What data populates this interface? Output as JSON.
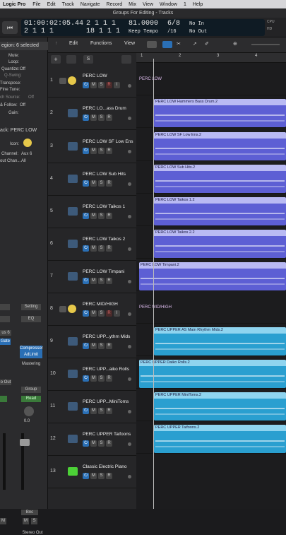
{
  "menubar": {
    "app": "Logic Pro",
    "items": [
      "File",
      "Edit",
      "Track",
      "Navigate",
      "Record",
      "Mix",
      "View",
      "Window",
      "1",
      "Help"
    ]
  },
  "window": {
    "title": "Groups For Editing - Tracks"
  },
  "transport": {
    "rewind_icon": "rewind-icon",
    "time": "01:00:02:05.44",
    "bars": "2  1  1  1",
    "bars2": "2  1  1  1",
    "bars3": "18  1  1  1",
    "tempo": "81.0000",
    "tempo_mode": "Keep Tempo",
    "sig": "6/8",
    "division": "/16",
    "in": "No In",
    "out": "No Out",
    "right_labels": [
      "CPU",
      "HD"
    ]
  },
  "inspector": {
    "region_label": "egion: 6 selected",
    "mute": "Mute:",
    "loop": "Loop:",
    "quantize": "Quantize:",
    "quantize_val": "Off",
    "qswing": "Q-Swing:",
    "transpose": "Transpose:",
    "finetune": "Fine Tune:",
    "source": "ch Source:",
    "source_val": "Off",
    "follow": "& Follow:",
    "follow_val": "Off",
    "gain": "Gain:",
    "track_label": "ack: PERC LOW",
    "icon": "Icon:",
    "channel": "Channel:",
    "channel_val": "Aux 6",
    "outchan": "out Chan...",
    "outchan_val": "All",
    "setting": "Setting",
    "eq": "EQ",
    "bus": "us 6",
    "gate": "Gate",
    "compressor": "Compressor",
    "adlimit": "AdLimit",
    "mastering": "Mastering",
    "out": "o Out",
    "group": "Group",
    "read": "Read",
    "val": "0.0",
    "bnc": "Bnc",
    "m": "M",
    "s": "S",
    "stereo_out": "Stereo Out",
    "read2": "Read"
  },
  "toolbar": {
    "edit": "Edit",
    "functions": "Functions",
    "view": "View"
  },
  "tracks": [
    {
      "num": "1",
      "name": "PERC LOW",
      "folder": true
    },
    {
      "num": "2",
      "name": "PERC LO...ass Drum"
    },
    {
      "num": "3",
      "name": "PERC LOW SF Low Ens"
    },
    {
      "num": "4",
      "name": "PERC LOW Sub Hits"
    },
    {
      "num": "5",
      "name": "PERC LOW Taikos 1"
    },
    {
      "num": "6",
      "name": "PERC LOW Taikos 2"
    },
    {
      "num": "7",
      "name": "PERC LOW Timpani"
    },
    {
      "num": "8",
      "name": "PERC MID/HIGH",
      "folder": true
    },
    {
      "num": "9",
      "name": "PERC UPP...ythm Mids"
    },
    {
      "num": "10",
      "name": "PERC UPP...aiko Rolls"
    },
    {
      "num": "11",
      "name": "PERC UPP...MiniToms"
    },
    {
      "num": "12",
      "name": "PERC UPPER Taifoons"
    },
    {
      "num": "13",
      "name": "Classic Electric Piano"
    }
  ],
  "track_buttons": {
    "m": "M",
    "s": "S",
    "r": "R",
    "i": "I"
  },
  "ruler": {
    "marks": [
      "1",
      "2",
      "3",
      "4"
    ]
  },
  "regions": [
    {
      "label": "PERC LOW",
      "kind": "folder"
    },
    {
      "label": "PERC LOW Hammers Bass Drum.2"
    },
    {
      "label": "PERC LOW SF Low Ens.2"
    },
    {
      "label": "PERC LOW Sub Hits.2"
    },
    {
      "label": "PERC LOW Taikos 1.2"
    },
    {
      "label": "PERC LOW Taikos 2.2"
    },
    {
      "label": "PERC LOW Timpani.2"
    },
    {
      "label": "PERC MID/HIGH",
      "kind": "folder"
    },
    {
      "label": "PERC UPPER AS Main Rhythm Mids.2"
    },
    {
      "label": "PERC UPPER Daiko Rolls.2"
    },
    {
      "label": "PERC UPPER MiniToms.2"
    },
    {
      "label": "PERC UPPER Taifoons.2"
    }
  ],
  "colors": {
    "purple": "#5d5fd4",
    "purple_head": "#b9baf3",
    "blue": "#2a9fd0",
    "blue_head": "#8fd4ef",
    "green": "#4cd137"
  }
}
